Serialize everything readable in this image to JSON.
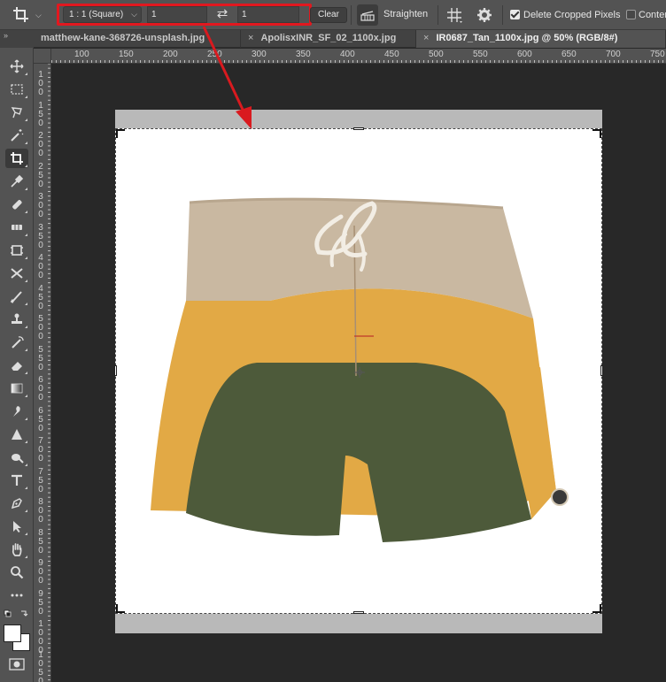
{
  "options_bar": {
    "ratio": "1 : 1 (Square)",
    "width_value": "1",
    "height_value": "1",
    "clear_label": "Clear",
    "straighten_label": "Straighten",
    "delete_cropped_label": "Delete Cropped Pixels",
    "delete_cropped_checked": true,
    "content_aware_label": "Conter",
    "content_aware_checked": false
  },
  "tabs": [
    {
      "label": "matthew-kane-368726-unsplash.jpg",
      "close": "×",
      "active": false
    },
    {
      "label": "ApolisxINR_SF_02_1100x.jpg",
      "close": "×",
      "active": false
    },
    {
      "label": "IR0687_Tan_1100x.jpg @ 50% (RGB/8#)",
      "close": "×",
      "active": true
    }
  ],
  "panel_collapse": "»",
  "ruler_top": [
    "100",
    "150",
    "200",
    "250",
    "300",
    "350",
    "400",
    "450",
    "500",
    "550",
    "600",
    "650",
    "700",
    "750"
  ],
  "ruler_left": [
    "1 0 0",
    "1 5 0",
    "2 0 0",
    "2 5 0",
    "3 0 0",
    "3 5 0",
    "4 0 0",
    "4 5 0",
    "5 0 0",
    "5 5 0",
    "6 0 0",
    "6 5 0",
    "7 0 0",
    "7 5 0",
    "8 0 0",
    "8 5 0",
    "9 0 0",
    "9 5 0",
    "1 0 0 0",
    "1 0 5 0"
  ],
  "colors": {
    "highlight": "#e2181f",
    "arrow": "#d91a1f",
    "tan": "#c9b8a1",
    "mustard": "#e2a945",
    "olive": "#4d5a3a"
  },
  "tools": [
    "move-icon",
    "marquee-icon",
    "lasso-icon",
    "magic-wand-icon",
    "crop-icon",
    "eyedropper-icon",
    "healing-icon",
    "bandage-icon",
    "frame-icon",
    "transform-icon",
    "brush-icon",
    "stamp-icon",
    "history-brush-icon",
    "eraser-icon",
    "gradient-icon",
    "smudge-icon",
    "sharpen-icon",
    "dodge-icon",
    "type-icon",
    "pen-icon",
    "path-select-icon",
    "hand-icon",
    "zoom-icon",
    "more-icon"
  ]
}
